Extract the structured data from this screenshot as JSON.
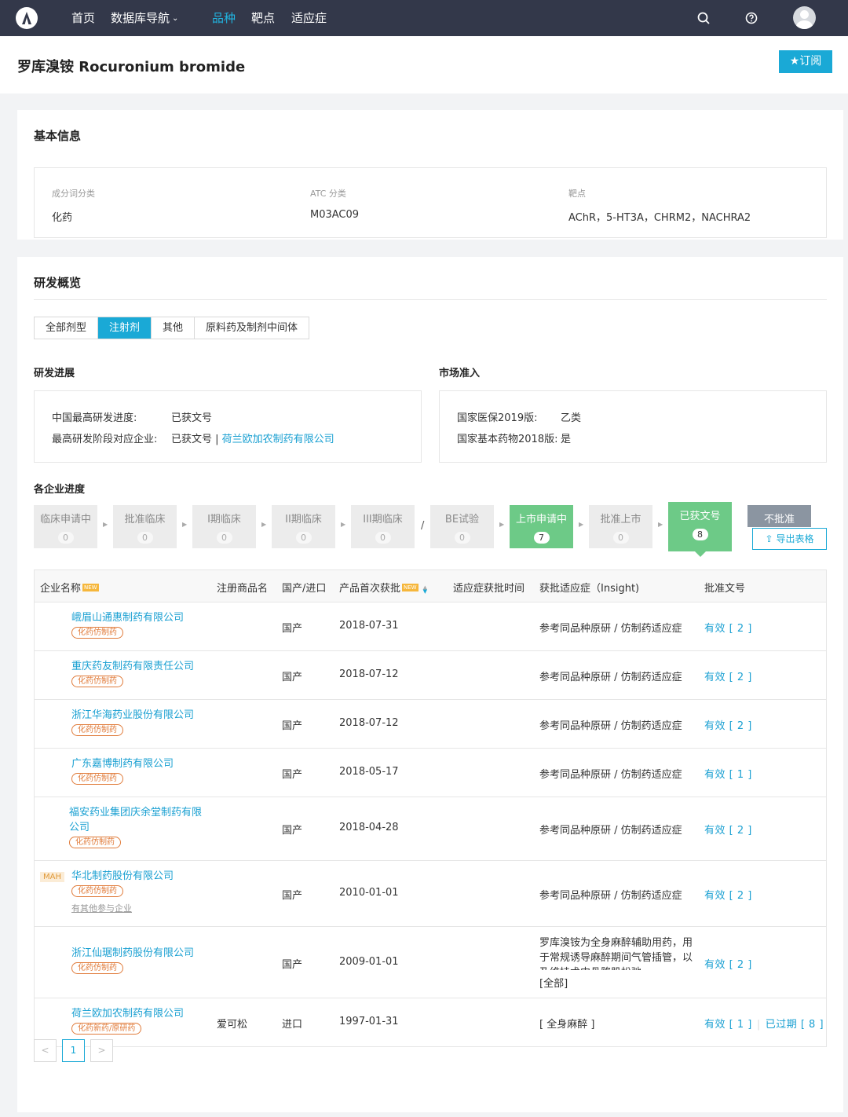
{
  "nav": {
    "items": [
      {
        "label": "首页"
      },
      {
        "label": "数据库导航"
      },
      {
        "label": "品种"
      },
      {
        "label": "靶点"
      },
      {
        "label": "适应症"
      }
    ],
    "active_index": 2,
    "icons": [
      "search-icon",
      "help-icon",
      "avatar"
    ]
  },
  "header": {
    "title": "罗库溴铵 Rocuronium bromide",
    "subscribe_label": "★订阅"
  },
  "basic_info": {
    "title": "基本信息",
    "fields": [
      {
        "label": "成分词分类",
        "value": "化药"
      },
      {
        "label": "ATC 分类",
        "value": "M03AC09"
      },
      {
        "label": "靶点",
        "value": "AChR，5-HT3A，CHRM2，NACHRA2"
      }
    ]
  },
  "rd": {
    "title": "研发概览",
    "tabs": [
      "全部剂型",
      "注射剂",
      "其他",
      "原料药及制剂中间体"
    ],
    "active_tab": 1,
    "progress": {
      "title": "研发进展",
      "china_label": "中国最高研发进度:",
      "china_value": "已获文号",
      "company_label": "最高研发阶段对应企业:",
      "company_stage": "已获文号 |",
      "company_name": "荷兰欧加农制药有限公司"
    },
    "market": {
      "title": "市场准入",
      "nrdl_label": "国家医保2019版:",
      "nrdl_value": "乙类",
      "ebl_label": "国家基本药物2018版:",
      "ebl_value": "是"
    },
    "stages_title": "各企业进度",
    "stages": [
      {
        "name": "临床申请中",
        "count": "0"
      },
      {
        "name": "批准临床",
        "count": "0"
      },
      {
        "name": "I期临床",
        "count": "0"
      },
      {
        "name": "II期临床",
        "count": "0"
      },
      {
        "name": "III期临床",
        "count": "0"
      },
      {
        "name": "BE试验",
        "count": "0"
      },
      {
        "name": "上市申请中",
        "count": "7"
      },
      {
        "name": "批准上市",
        "count": "0"
      },
      {
        "name": "已获文号",
        "count": "8"
      },
      {
        "name": "不批准",
        "count": ""
      }
    ],
    "slash": "/",
    "export_label": "导出表格"
  },
  "table": {
    "columns": [
      "企业名称",
      "注册商品名",
      "国产/进口",
      "产品首次获批",
      "适应症获批时间",
      "获批适应症（Insight)",
      "批准文号"
    ],
    "new_badge": "NEW",
    "rows": [
      {
        "company": "峨眉山通惠制药有限公司",
        "tag": "化药仿制药",
        "brand": "",
        "origin": "国产",
        "date": "2018-07-31",
        "indication": "参考同品种原研 / 仿制药适应症",
        "approval": "有效 [ 2 ]"
      },
      {
        "company": "重庆药友制药有限责任公司",
        "tag": "化药仿制药",
        "brand": "",
        "origin": "国产",
        "date": "2018-07-12",
        "indication": "参考同品种原研 / 仿制药适应症",
        "approval": "有效 [ 2 ]"
      },
      {
        "company": "浙江华海药业股份有限公司",
        "tag": "化药仿制药",
        "brand": "",
        "origin": "国产",
        "date": "2018-07-12",
        "indication": "参考同品种原研 / 仿制药适应症",
        "approval": "有效 [ 2 ]"
      },
      {
        "company": "广东嘉博制药有限公司",
        "tag": "化药仿制药",
        "brand": "",
        "origin": "国产",
        "date": "2018-05-17",
        "indication": "参考同品种原研 / 仿制药适应症",
        "approval": "有效 [ 1 ]"
      },
      {
        "company": "福安药业集团庆余堂制药有限公司",
        "tag": "化药仿制药",
        "brand": "",
        "origin": "国产",
        "date": "2018-04-28",
        "indication": "参考同品种原研 / 仿制药适应症",
        "approval": "有效 [ 2 ]"
      },
      {
        "company": "华北制药股份有限公司",
        "tag": "化药仿制药",
        "mah": "MAH",
        "note": "有其他参与企业",
        "brand": "",
        "origin": "国产",
        "date": "2010-01-01",
        "indication": "参考同品种原研 / 仿制药适应症",
        "approval": "有效 [ 2 ]"
      },
      {
        "company": "浙江仙琚制药股份有限公司",
        "tag": "化药仿制药",
        "brand": "",
        "origin": "国产",
        "date": "2009-01-01",
        "indication": "罗库溴铵为全身麻醉辅助用药，用于常规诱导麻醉期间气管插管，以及维持术中骨骼肌松弛。",
        "indication_more": "[全部]",
        "approval": "有效 [ 2 ]"
      },
      {
        "company": "荷兰欧加农制药有限公司",
        "tag": "化药新药/原研药",
        "brand": "爱可松",
        "origin": "进口",
        "date": "1997-01-31",
        "indication": "[ 全身麻醉 ]",
        "approval": "有效 [ 1 ]",
        "approval2": "已过期 [ 8 ]"
      }
    ]
  },
  "pagination": {
    "prev": "<",
    "current": "1",
    "next": ">"
  }
}
